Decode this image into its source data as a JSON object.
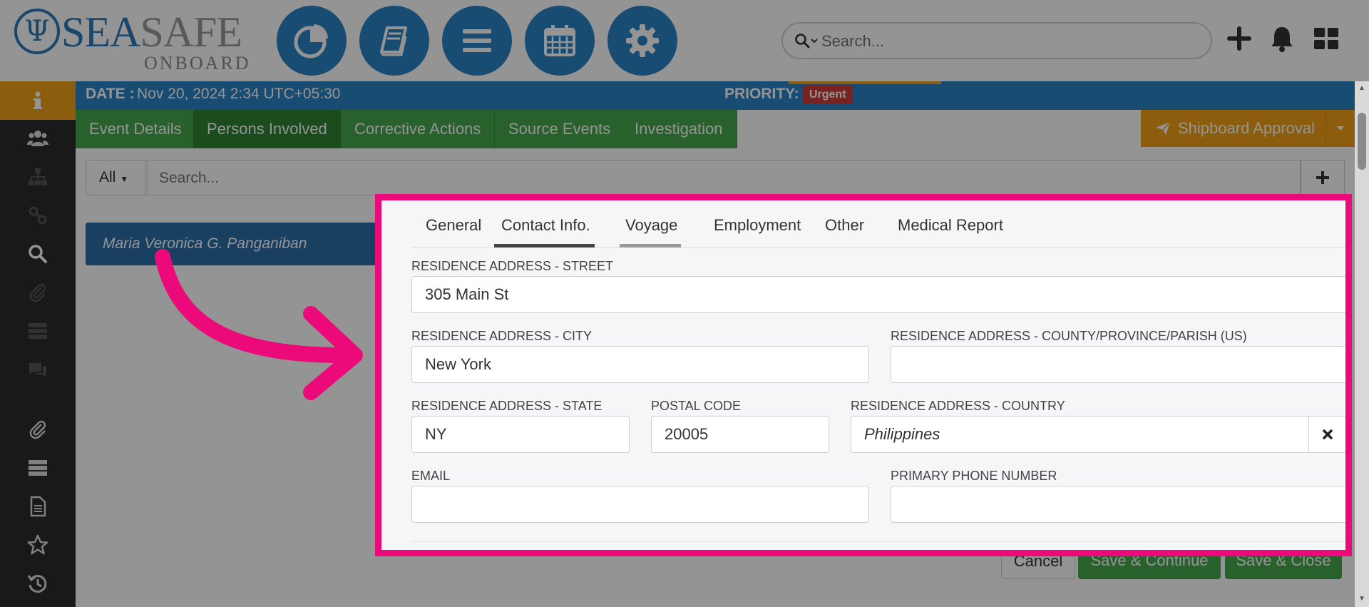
{
  "brand": {
    "name_part1": "SEA",
    "name_part2": "SAFE",
    "subtitle": "ONBOARD",
    "logo_glyph": "Ψ"
  },
  "top_nav": {
    "icons": [
      "pie-chart-icon",
      "book-icon",
      "list-icon",
      "calendar-icon",
      "gear-icon"
    ],
    "circle_color": "#2b84c6",
    "search_placeholder": "Search..."
  },
  "header": {
    "date_label": "DATE :",
    "date_value": "Nov 20, 2024 2:34 UTC+05:30",
    "priority_label": "PRIORITY:",
    "priority_value": "Urgent"
  },
  "tabs": [
    {
      "label": "Event Details",
      "active": false
    },
    {
      "label": "Persons Involved",
      "active": true
    },
    {
      "label": "Corrective Actions",
      "active": false
    },
    {
      "label": "Source Events",
      "active": false
    },
    {
      "label": "Investigation",
      "active": false
    }
  ],
  "approval": {
    "label": "Shipboard Approval"
  },
  "filter": {
    "all_label": "All",
    "search_placeholder": "Search..."
  },
  "person": {
    "name": "Maria Veronica G. Panganiban"
  },
  "footer_buttons": {
    "cancel": "Cancel",
    "save_continue": "Save & Continue",
    "save_close": "Save & Close"
  },
  "panel": {
    "tabs": [
      {
        "label": "General"
      },
      {
        "label": "Contact Info."
      },
      {
        "label": "Voyage"
      },
      {
        "label": "Employment"
      },
      {
        "label": "Other"
      },
      {
        "label": "Medical Report"
      }
    ],
    "active_tab": "Contact Info.",
    "fields": {
      "street": {
        "label": "RESIDENCE ADDRESS - STREET",
        "value": "305 Main St"
      },
      "city": {
        "label": "RESIDENCE ADDRESS - CITY",
        "value": "New York"
      },
      "county": {
        "label": "RESIDENCE ADDRESS - COUNTY/PROVINCE/PARISH (US)",
        "value": ""
      },
      "state": {
        "label": "RESIDENCE ADDRESS - STATE",
        "value": "NY"
      },
      "postal": {
        "label": "POSTAL CODE",
        "value": "20005"
      },
      "country": {
        "label": "RESIDENCE ADDRESS - COUNTRY",
        "value": "Philippines"
      },
      "email": {
        "label": "EMAIL",
        "value": ""
      },
      "phone": {
        "label": "PRIMARY PHONE NUMBER",
        "value": ""
      }
    }
  },
  "colors": {
    "highlight": "#ec0a7b",
    "green": "#47a84c",
    "orange": "#f0a015",
    "blue": "#2b84c6",
    "urgent": "#cf3b3b"
  }
}
